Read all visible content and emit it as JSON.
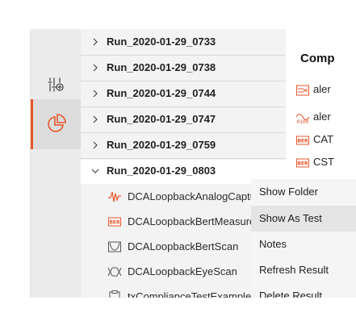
{
  "tree": {
    "runs": [
      {
        "label": "Run_2020-01-29_0733",
        "expanded": false
      },
      {
        "label": "Run_2020-01-29_0738",
        "expanded": false
      },
      {
        "label": "Run_2020-01-29_0744",
        "expanded": false
      },
      {
        "label": "Run_2020-01-29_0747",
        "expanded": false
      },
      {
        "label": "Run_2020-01-29_0759",
        "expanded": false
      },
      {
        "label": "Run_2020-01-29_0803",
        "expanded": true
      }
    ],
    "children": [
      {
        "label": "DCALoopbackAnalogCapture",
        "icon": "waveform-icon"
      },
      {
        "label": "DCALoopbackBertMeasurement",
        "icon": "ber-icon"
      },
      {
        "label": "DCALoopbackBertScan",
        "icon": "bathtub-icon"
      },
      {
        "label": "DCALoopbackEyeScan",
        "icon": "eye-diagram-icon"
      },
      {
        "label": "txComplianceTestExample",
        "icon": "clipboard-icon"
      }
    ]
  },
  "content": {
    "title": "Comp",
    "rows": [
      {
        "label": "aler",
        "icon": "alert-flow-icon"
      },
      {
        "label": "aler",
        "icon": "alert-binary-icon"
      },
      {
        "label": "CAT",
        "icon": "ber-icon"
      },
      {
        "label": "CST",
        "icon": "ber-icon"
      }
    ]
  },
  "context_menu": {
    "items": [
      {
        "label": "Show Folder"
      },
      {
        "label": "Show As Test"
      },
      {
        "label": "Notes"
      },
      {
        "label": "Refresh Result"
      },
      {
        "label": "Delete Result"
      }
    ],
    "hover_index": 1
  },
  "rail": {
    "buttons": [
      {
        "icon": "sliders-add-icon"
      },
      {
        "icon": "pie-chart-icon"
      }
    ],
    "active_index": 1
  },
  "colors": {
    "accent": "#e8562a",
    "tree_bg": "#f3f3f3",
    "selected_row": "#ffffff",
    "menu_hover": "#e5e5e5"
  }
}
